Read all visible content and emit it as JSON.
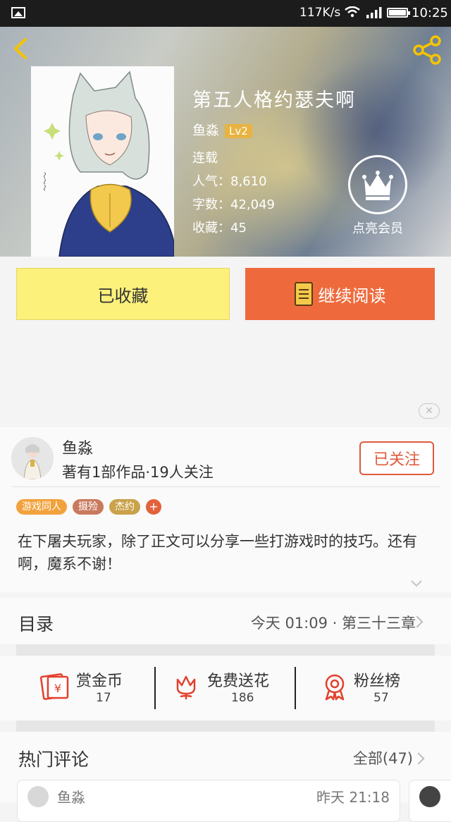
{
  "status_bar": {
    "speed": "117K/s",
    "time": "10:25"
  },
  "book": {
    "title": "第五人格约瑟夫啊",
    "author": "鱼淼",
    "level": "Lv2",
    "status": "连载",
    "popularity": "人气：8,610",
    "word_count": "字数：42,049",
    "favorites": "收藏：45"
  },
  "vip": {
    "label": "点亮会员"
  },
  "actions": {
    "collected_label": "已收藏",
    "continue_label": "继续阅读"
  },
  "author_card": {
    "name": "鱼淼",
    "stats": "著有1部作品·19人关注",
    "follow_label": "已关注",
    "tags": [
      {
        "label": "游戏同人",
        "color": "#f2a23c"
      },
      {
        "label": "摄殓",
        "color": "#c97a5e"
      },
      {
        "label": "杰约",
        "color": "#c9a24a"
      }
    ],
    "add_tag": "+",
    "intro": "在下屠夫玩家，除了正文可以分享一些打游戏时的技巧。还有啊，魔系不谢！"
  },
  "toc": {
    "title": "目录",
    "latest": "今天 01:09 · 第三十三章"
  },
  "stats": {
    "reward": {
      "label": "赏金币",
      "value": "17"
    },
    "flowers": {
      "label": "免费送花",
      "value": "186"
    },
    "fans": {
      "label": "粉丝榜",
      "value": "57"
    }
  },
  "comments": {
    "title": "热门评论",
    "all_label": "全部(47)",
    "first": {
      "user": "鱼淼",
      "time": "昨天 21:18"
    }
  },
  "colors": {
    "accent": "#ee6a3c",
    "collected_bg": "#fbf17b",
    "follow": "#e05a3c"
  }
}
